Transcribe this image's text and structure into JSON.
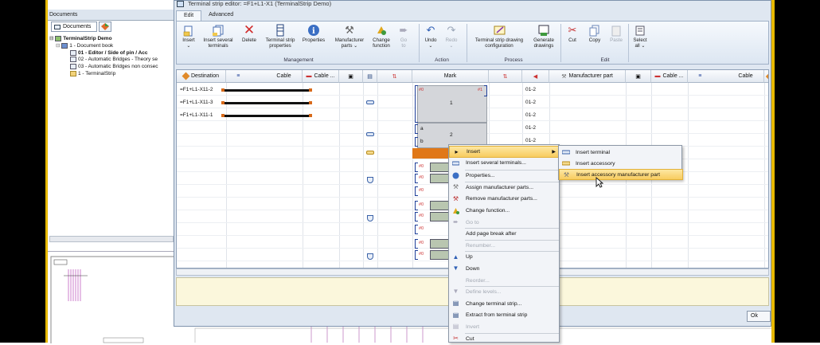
{
  "window": {
    "title": "Terminal strip editor: =F1+L1-X1 (TerminalStrip Demo)"
  },
  "colors": {
    "accent_orange": "#e07818",
    "highlight": "#f8cc5f",
    "frame_yellow": "#e6b800"
  },
  "docs_panel": {
    "header": "Documents",
    "tab_label": "Documents",
    "tree": [
      "TerminalStrip Demo",
      "1 - Document book",
      "01 - Editor / Side of pin / Acc",
      "02 - Automatic Bridges - Theory se",
      "03 - Automatic Bridges non consec",
      "1 - TerminalStrip"
    ]
  },
  "ribbon": {
    "tabs": [
      "Edit",
      "Advanced"
    ],
    "buttons": [
      {
        "label": "Insert",
        "sub": "⌄",
        "icon": "insert-icon"
      },
      {
        "label": "Insert several",
        "sub": "terminals",
        "icon": "insert-several-icon"
      },
      {
        "label": "Delete",
        "sub": "",
        "icon": "delete-icon"
      },
      {
        "label": "Terminal strip",
        "sub": "properties",
        "icon": "terminal-strip-properties-icon"
      },
      {
        "label": "Properties",
        "sub": "",
        "icon": "properties-icon"
      },
      {
        "label": "Manufacturer",
        "sub": "parts ⌄",
        "icon": "manufacturer-parts-icon"
      },
      {
        "label": "Change",
        "sub": "function",
        "icon": "change-function-icon"
      },
      {
        "label": "Go",
        "sub": "to",
        "icon": "goto-icon"
      },
      {
        "label": "Undo",
        "sub": "⌄",
        "icon": "undo-icon"
      },
      {
        "label": "Redo",
        "sub": "⌄",
        "icon": "redo-icon"
      },
      {
        "label": "Terminal strip drawing",
        "sub": "configuration",
        "icon": "drawing-config-icon"
      },
      {
        "label": "Generate",
        "sub": "drawings",
        "icon": "generate-drawings-icon"
      },
      {
        "label": "Cut",
        "sub": "",
        "icon": "cut-icon"
      },
      {
        "label": "Copy",
        "sub": "",
        "icon": "copy-icon"
      },
      {
        "label": "Paste",
        "sub": "",
        "icon": "paste-icon"
      },
      {
        "label": "Select",
        "sub": "all ⌄",
        "icon": "select-all-icon"
      }
    ],
    "groups": [
      "Management",
      "Action",
      "Process",
      "Edit"
    ]
  },
  "grid": {
    "headers": [
      "Destination",
      "Cable",
      "Cable ...",
      "",
      "",
      "",
      "Mark",
      "",
      "",
      "Manufacturer part",
      "",
      "Cable ...",
      "Cable",
      ""
    ],
    "rows": [
      {
        "destination": "=F1+L1-X11-2",
        "mark": "1",
        "level": "01-2"
      },
      {
        "destination": "=F1+L1-X11-3",
        "mark": "",
        "level": "01-2"
      },
      {
        "destination": "=F1+L1-X11-1",
        "mark": "",
        "level": "01-2"
      },
      {
        "destination": "",
        "mark_a": "a",
        "mark": "2",
        "level": "01-2"
      },
      {
        "destination": "",
        "mark_a": "b",
        "mark": "",
        "level": "01-2"
      }
    ],
    "small_label": "#0",
    "small_label_r": "#1"
  },
  "context_menu": {
    "items": [
      {
        "label": "Insert",
        "icon": "insert-icon",
        "disabled": false,
        "submenu": true
      },
      {
        "label": "Insert several terminals...",
        "icon": "insert-several-icon",
        "disabled": false
      },
      {
        "label": "Properties...",
        "icon": "properties-icon",
        "disabled": false
      },
      {
        "label": "Assign manufacturer parts...",
        "icon": "assign-parts-icon",
        "disabled": false
      },
      {
        "label": "Remove manufacturer parts...",
        "icon": "remove-parts-icon",
        "disabled": false
      },
      {
        "label": "Change function...",
        "icon": "change-function-icon",
        "disabled": false
      },
      {
        "label": "Go to",
        "icon": "goto-icon",
        "disabled": true
      },
      {
        "label": "Add page break after",
        "icon": "",
        "disabled": false
      },
      {
        "label": "Renumber...",
        "icon": "",
        "disabled": true
      },
      {
        "label": "Up",
        "icon": "up-icon",
        "disabled": false
      },
      {
        "label": "Down",
        "icon": "down-icon",
        "disabled": false
      },
      {
        "label": "Reorder...",
        "icon": "",
        "disabled": true
      },
      {
        "label": "Define levels...",
        "icon": "levels-icon",
        "disabled": true
      },
      {
        "label": "Change terminal strip...",
        "icon": "change-strip-icon",
        "disabled": false
      },
      {
        "label": "Extract from terminal strip",
        "icon": "extract-icon",
        "disabled": false
      },
      {
        "label": "Invert",
        "icon": "invert-icon",
        "disabled": true
      },
      {
        "label": "Cut",
        "icon": "cut-icon",
        "disabled": false
      }
    ],
    "submenu": [
      {
        "label": "Insert terminal",
        "icon": "terminal-icon"
      },
      {
        "label": "Insert accessory",
        "icon": "accessory-icon"
      },
      {
        "label": "Insert accessory manufacturer part",
        "icon": "accessory-part-icon"
      }
    ]
  },
  "buttons": {
    "ok": "Ok"
  }
}
